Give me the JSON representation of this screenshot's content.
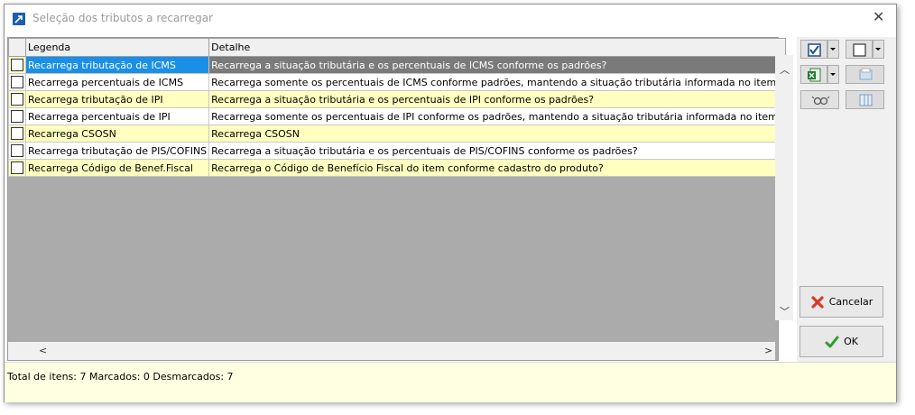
{
  "window": {
    "title": "Seleção dos tributos a recarregar"
  },
  "grid": {
    "headers": {
      "legenda": "Legenda",
      "detalhe": "Detalhe"
    },
    "rows": [
      {
        "legenda": "Recarrega tributação de ICMS",
        "detalhe": "Recarrega a situação tributária e os percentuais de ICMS conforme os padrões?",
        "checked": false,
        "selected": true
      },
      {
        "legenda": "Recarrega percentuais de ICMS",
        "detalhe": "Recarrega somente os percentuais de ICMS conforme padrões, mantendo a situação tributária informada no item?",
        "checked": false
      },
      {
        "legenda": "Recarrega tributação de IPI",
        "detalhe": "Recarrega a situação tributária e os percentuais de IPI conforme os padrões?",
        "checked": false
      },
      {
        "legenda": "Recarrega percentuais de IPI",
        "detalhe": "Recarrega somente os percentuais de IPI conforme os padrões, mantendo a situação tributária informada no item?",
        "checked": false
      },
      {
        "legenda": "Recarrega CSOSN",
        "detalhe": "Recarrega CSOSN",
        "checked": false
      },
      {
        "legenda": "Recarrega tributação de PIS/COFINS",
        "detalhe": "Recarrega a situação tributária e os percentuais de PIS/COFINS conforme os padrões?",
        "checked": false
      },
      {
        "legenda": "Recarrega Código de Benef.Fiscal",
        "detalhe": "Recarrega o Código de Benefício Fiscal do item conforme cadastro do produto?",
        "checked": false
      }
    ]
  },
  "buttons": {
    "cancel": "Cancelar",
    "ok": "OK"
  },
  "status": {
    "text": "Total de itens: 7 Marcados: 0 Desmarcados: 7"
  },
  "colors": {
    "row_alt": "#ffffc0",
    "selection": "#1a8fe8",
    "status_bg": "#ffffe1"
  }
}
